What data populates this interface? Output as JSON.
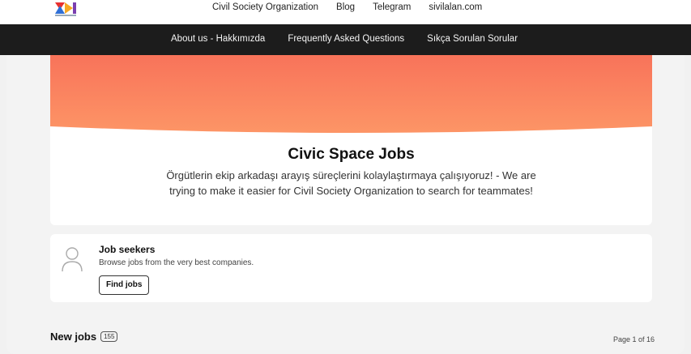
{
  "header": {
    "logo_icon": "civic-space-logo-icon",
    "links": [
      {
        "label": "Civil Society Organization"
      },
      {
        "label": "Blog"
      },
      {
        "label": "Telegram"
      },
      {
        "label": "sivilalan.com"
      }
    ]
  },
  "nav": {
    "links": [
      {
        "label": "About us - Hakkımızda"
      },
      {
        "label": "Frequently Asked Questions"
      },
      {
        "label": "Sıkça Sorulan Sorular"
      }
    ]
  },
  "hero": {
    "title": "Civic Space Jobs",
    "subtitle": "Örgütlerin ekip arkadaşı arayış süreçlerini kolaylaştırmaya çalışıyoruz! - We are trying to make it easier for Civil Society Organization to search for teammates!",
    "banner_color_top": "#f8735a",
    "banner_color_bottom": "#fd9566"
  },
  "job_seekers": {
    "icon": "user-icon",
    "title": "Job seekers",
    "description": "Browse jobs from the very best companies.",
    "button_label": "Find jobs"
  },
  "listing": {
    "title": "New jobs",
    "count": "155",
    "page_label": "Page 1 of 16"
  },
  "colors": {
    "navbar_bg": "#1c1c1c",
    "page_bg": "#f1f1f1"
  }
}
